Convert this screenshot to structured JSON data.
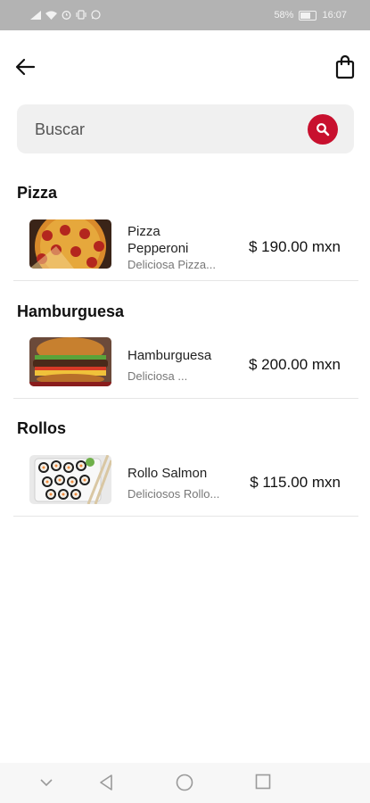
{
  "status_bar": {
    "battery": "58%",
    "time": "16:07",
    "left_icons": [
      "signal-icon",
      "wifi-icon",
      "alarm-icon",
      "vibrate-icon",
      "whatsapp-icon"
    ]
  },
  "header": {
    "back_icon": "arrow-left-icon",
    "cart_icon": "shopping-bag-icon"
  },
  "search": {
    "placeholder": "Buscar",
    "icon": "search-icon",
    "accent_color": "#c8102e"
  },
  "sections": [
    {
      "title": "Pizza",
      "items": [
        {
          "name": "Pizza Pepperoni",
          "description": "Deliciosa Pizza...",
          "price": "$ 190.00 mxn",
          "image": "pizza-image"
        }
      ]
    },
    {
      "title": "Hamburguesa",
      "items": [
        {
          "name": "Hamburguesa",
          "description": "Deliciosa ...",
          "price": "$ 200.00 mxn",
          "image": "burger-image"
        }
      ]
    },
    {
      "title": "Rollos",
      "items": [
        {
          "name": "Rollo Salmon",
          "description": "Deliciosos Rollo...",
          "price": "$ 115.00 mxn",
          "image": "sushi-image"
        }
      ]
    }
  ],
  "nav_bar": {
    "buttons": [
      "chevron-down-icon",
      "back-triangle-icon",
      "home-circle-icon",
      "recents-square-icon"
    ]
  }
}
